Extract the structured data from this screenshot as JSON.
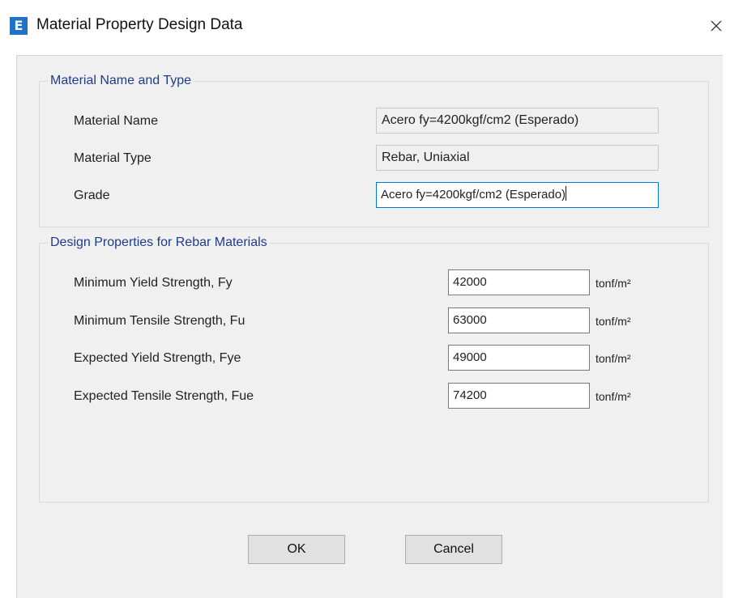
{
  "window": {
    "title": "Material Property Design Data",
    "app_icon_letter": "E",
    "close_glyph": "✕"
  },
  "group_name_type": {
    "legend": "Material Name and Type",
    "material_name_label": "Material Name",
    "material_name_value": "Acero fy=4200kgf/cm2 (Esperado)",
    "material_type_label": "Material Type",
    "material_type_value": "Rebar, Uniaxial",
    "grade_label": "Grade",
    "grade_value": "Acero fy=4200kgf/cm2 (Esperado)"
  },
  "group_design": {
    "legend": "Design Properties for Rebar Materials",
    "rows": [
      {
        "label": "Minimum Yield Strength, Fy",
        "value": "42000",
        "unit": "tonf/m²"
      },
      {
        "label": "Minimum Tensile Strength, Fu",
        "value": "63000",
        "unit": "tonf/m²"
      },
      {
        "label": "Expected Yield Strength, Fye",
        "value": "49000",
        "unit": "tonf/m²"
      },
      {
        "label": "Expected Tensile Strength, Fue",
        "value": "74200",
        "unit": "tonf/m²"
      }
    ]
  },
  "buttons": {
    "ok": "OK",
    "cancel": "Cancel"
  },
  "colors": {
    "legend_text": "#1f3c8c",
    "app_icon": "#1e73c8",
    "focus_border": "#0078d7",
    "dialog_bg": "#f0f0f0"
  }
}
